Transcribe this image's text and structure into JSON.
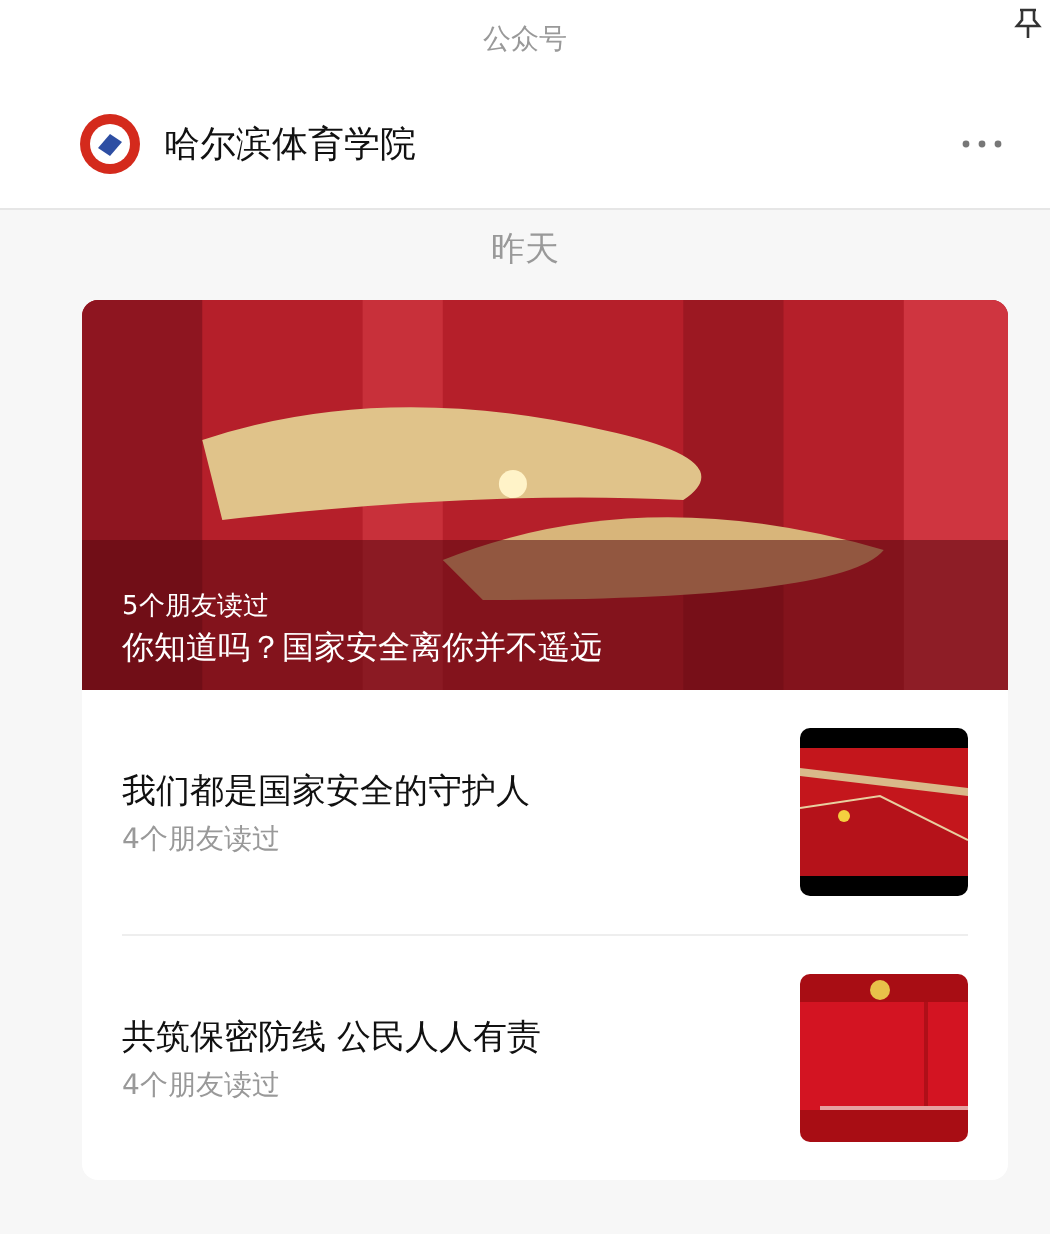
{
  "window": {
    "title": "公众号"
  },
  "account": {
    "name": "哈尔滨体育学院"
  },
  "date_label": "昨天",
  "lead_article": {
    "kind": "picture",
    "readers": "5个朋友读过",
    "title": "你知道吗？国家安全离你并不遥远"
  },
  "articles": [
    {
      "title": "我们都是国家安全的守护人",
      "readers": "4个朋友读过",
      "kind": "picture"
    },
    {
      "title": "共筑保密防线 公民人人有责",
      "readers": "4个朋友读过",
      "kind": "picture"
    }
  ]
}
